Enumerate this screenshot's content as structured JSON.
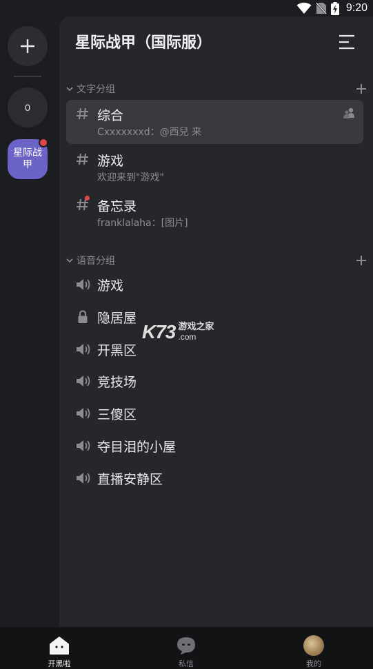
{
  "status_bar": {
    "time": "9:20"
  },
  "rail": {
    "add_icon": "plus-icon",
    "dm_count": "0",
    "server_short_name": "星际战甲"
  },
  "server": {
    "title": "星际战甲（国际服）"
  },
  "text_group": {
    "label": "文字分组",
    "channels": [
      {
        "name": "综合",
        "last_message": "Cxxxxxxxd：@西兒 来",
        "active": true
      },
      {
        "name": "游戏",
        "last_message": "欢迎来到\"游戏\"",
        "active": false
      },
      {
        "name": "备忘录",
        "last_message": "franklalaha：[图片]",
        "active": false,
        "unread": true
      }
    ]
  },
  "voice_group": {
    "label": "语音分组",
    "channels": [
      {
        "name": "游戏",
        "icon": "speaker-icon"
      },
      {
        "name": "隐居屋",
        "icon": "lock-icon"
      },
      {
        "name": "开黑区",
        "icon": "speaker-icon"
      },
      {
        "name": "竞技场",
        "icon": "speaker-icon"
      },
      {
        "name": "三傻区",
        "icon": "speaker-icon"
      },
      {
        "name": "夺目泪的小屋",
        "icon": "speaker-icon"
      },
      {
        "name": "直播安静区",
        "icon": "speaker-icon"
      }
    ]
  },
  "watermark": {
    "logo": "K73",
    "text": "游戏之家",
    "domain": ".com"
  },
  "bottom_nav": {
    "items": [
      {
        "label": "开黑啦",
        "icon": "home-icon",
        "active": true
      },
      {
        "label": "私信",
        "icon": "chat-bubble-icon",
        "active": false
      },
      {
        "label": "我的",
        "icon": "avatar",
        "active": false
      }
    ]
  },
  "colors": {
    "accent": "#6c63c6",
    "unread": "#e04848",
    "panel": "#26272b",
    "active_row": "#393a40"
  }
}
